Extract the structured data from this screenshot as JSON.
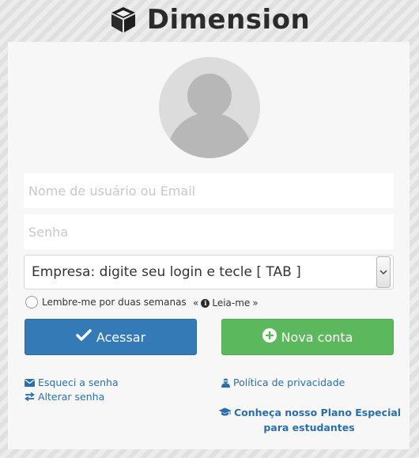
{
  "header": {
    "brand": "Dimension",
    "logo_icon": "cube-icon"
  },
  "login": {
    "avatar_icon": "user-avatar-icon",
    "username_placeholder": "Nome de usuário ou Email",
    "password_placeholder": "Senha",
    "company_select": {
      "selected": "Empresa: digite seu login e tecle [ TAB ]"
    },
    "remember_me": "Lembre-me por duas semanas",
    "read_me": {
      "prefix": "«",
      "label": "Leia-me",
      "suffix": "»"
    },
    "access_button": "Acessar",
    "new_account_button": "Nova conta"
  },
  "links": {
    "forgot_password": "Esqueci a senha",
    "change_password": "Alterar senha",
    "privacy_policy": "Política de privacidade",
    "student_plan": {
      "line1": "Conheça nosso Plano Especial",
      "line2": "para estudantes"
    }
  },
  "colors": {
    "primary": "#337ab7",
    "success": "#5cb85c",
    "link": "#2a6fad"
  }
}
